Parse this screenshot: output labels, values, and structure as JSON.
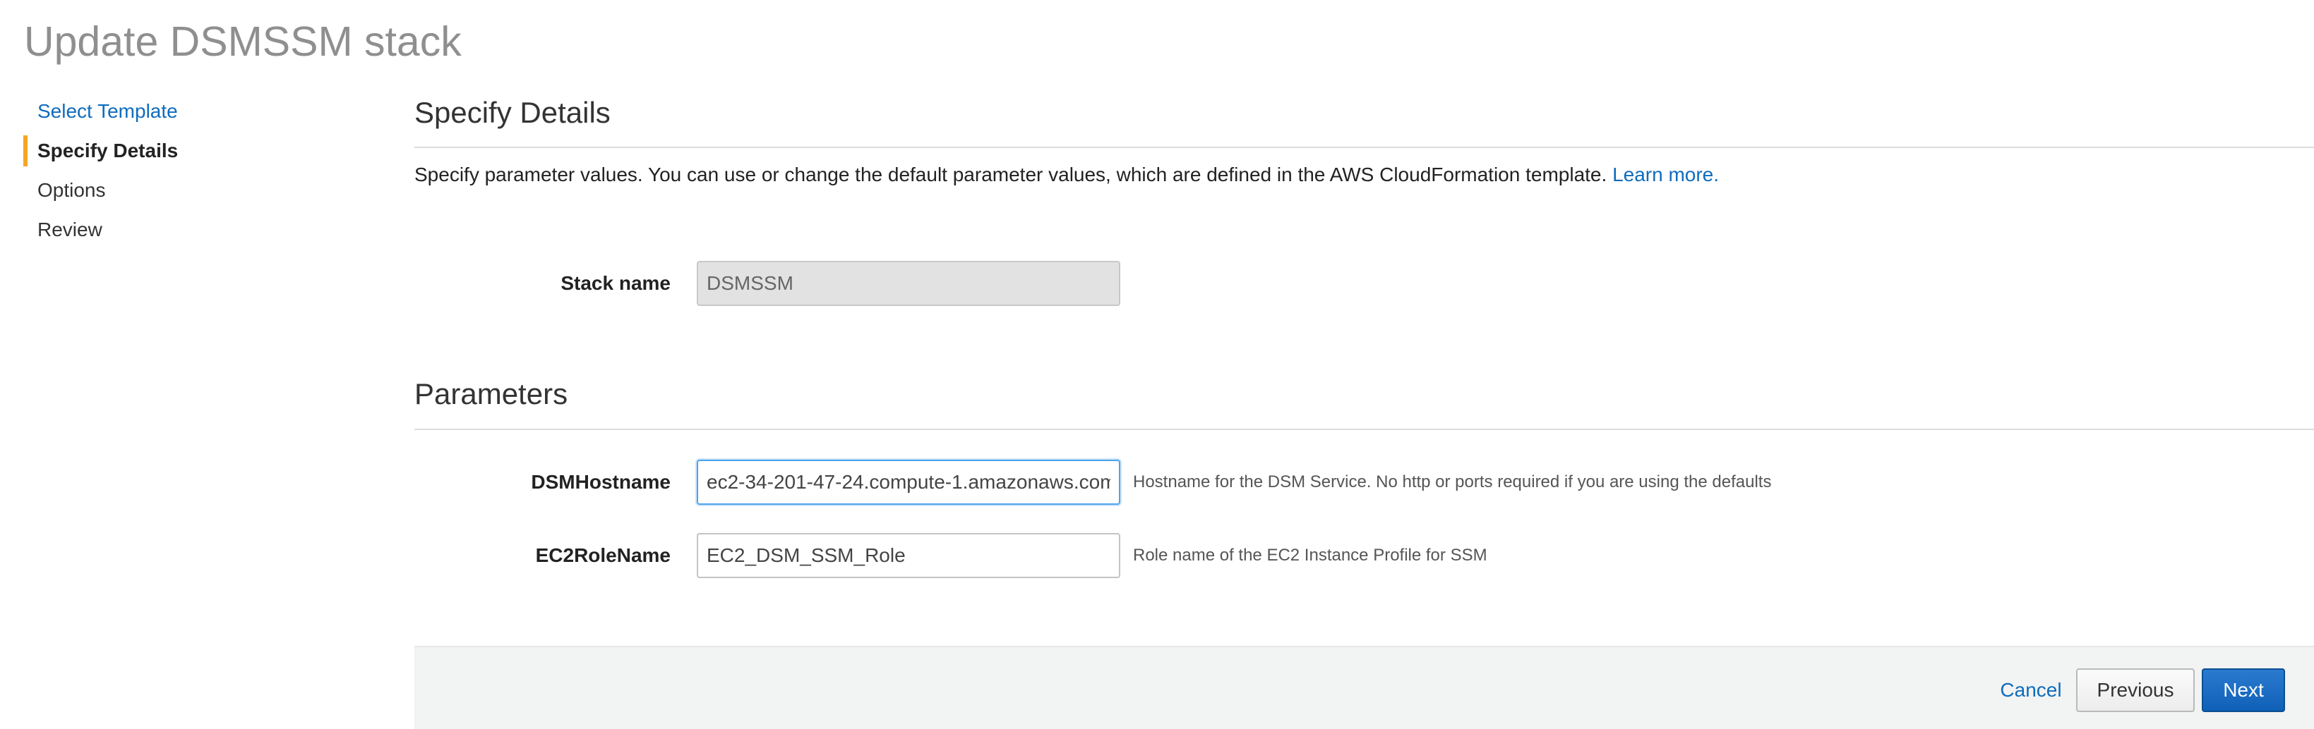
{
  "page": {
    "title": "Update DSMSSM stack"
  },
  "wizard": {
    "steps": [
      {
        "label": "Select Template",
        "state": "link"
      },
      {
        "label": "Specify Details",
        "state": "active"
      },
      {
        "label": "Options",
        "state": "pending"
      },
      {
        "label": "Review",
        "state": "pending"
      }
    ]
  },
  "details": {
    "heading": "Specify Details",
    "intro": "Specify parameter values. You can use or change the default parameter values, which are defined in the AWS CloudFormation template.",
    "learn_more": "Learn more.",
    "stack_name_label": "Stack name",
    "stack_name_value": "DSMSSM"
  },
  "parameters": {
    "heading": "Parameters",
    "fields": [
      {
        "label": "DSMHostname",
        "value": "ec2-34-201-47-24.compute-1.amazonaws.com",
        "help": "Hostname for the DSM Service. No http or ports required if you are using the defaults"
      },
      {
        "label": "EC2RoleName",
        "value": "EC2_DSM_SSM_Role",
        "help": "Role name of the EC2 Instance Profile for SSM"
      }
    ]
  },
  "footer": {
    "cancel_label": "Cancel",
    "previous_label": "Previous",
    "next_label": "Next"
  },
  "colors": {
    "link": "#0f6cbd",
    "active_step_marker": "#f5a623",
    "primary_button": "#1166bb",
    "focus_border": "#4da3ea"
  }
}
